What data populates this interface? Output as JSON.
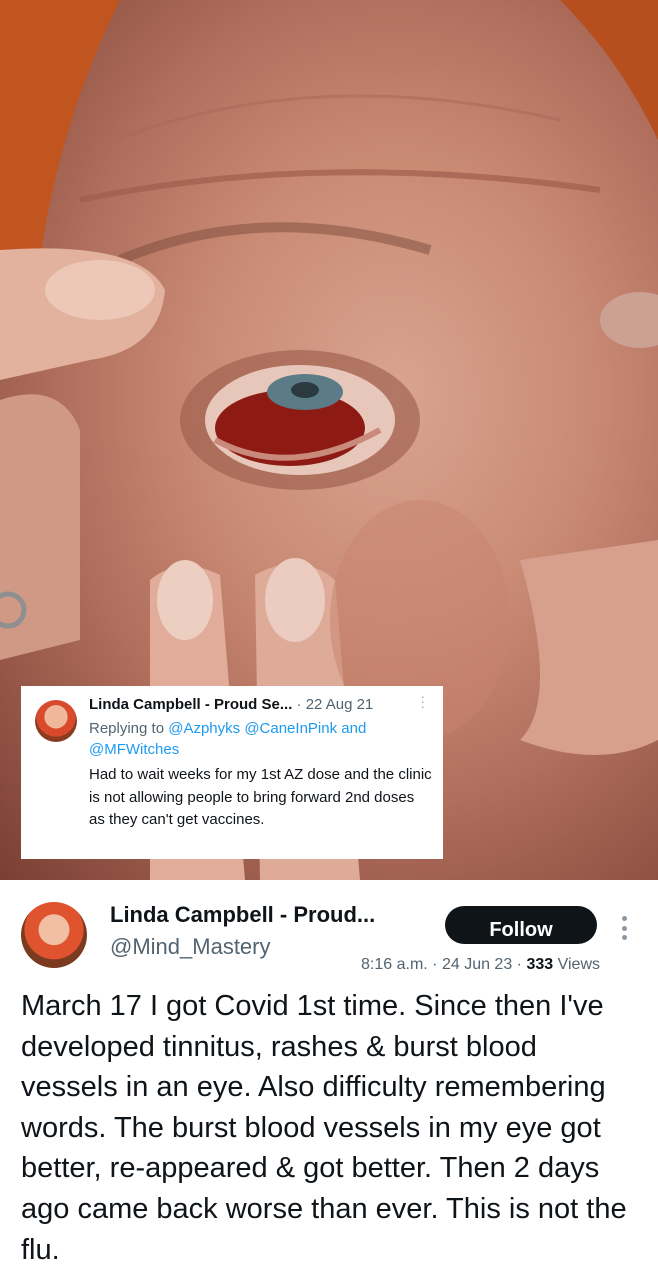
{
  "reply": {
    "name": "Linda Campbell - Proud Se...",
    "date": "· 22 Aug 21",
    "replying_prefix": "Replying to",
    "mentions": [
      "@Azphyks",
      "@CaneInPink",
      "and",
      "@MFWitches"
    ],
    "text": "Had to wait weeks for my 1st AZ dose and the clinic is not allowing people to bring forward 2nd doses as they can't get vaccines."
  },
  "tweet": {
    "name": "Linda Campbell - Proud...",
    "handle": "@Mind_Mastery",
    "follow_label": "Follow",
    "time": "8:16 a.m.",
    "date": "· 24 Jun 23 ·",
    "views_count": "333",
    "views_label": "Views",
    "text": "March 17 I got Covid 1st time. Since then I've developed tinnitus, rashes & burst blood vessels in an eye. Also difficulty remembering words. The burst blood vessels in my eye got better, re-appeared & got better. Then 2 days ago came back worse than ever.  This is not the flu."
  },
  "icons": {
    "reply_menu": "more-vertical-icon",
    "tweet_menu": "more-vertical-icon"
  },
  "colors": {
    "link": "#1d9bf0",
    "text": "#0f1419",
    "muted": "#536471",
    "button": "#0f1419"
  }
}
